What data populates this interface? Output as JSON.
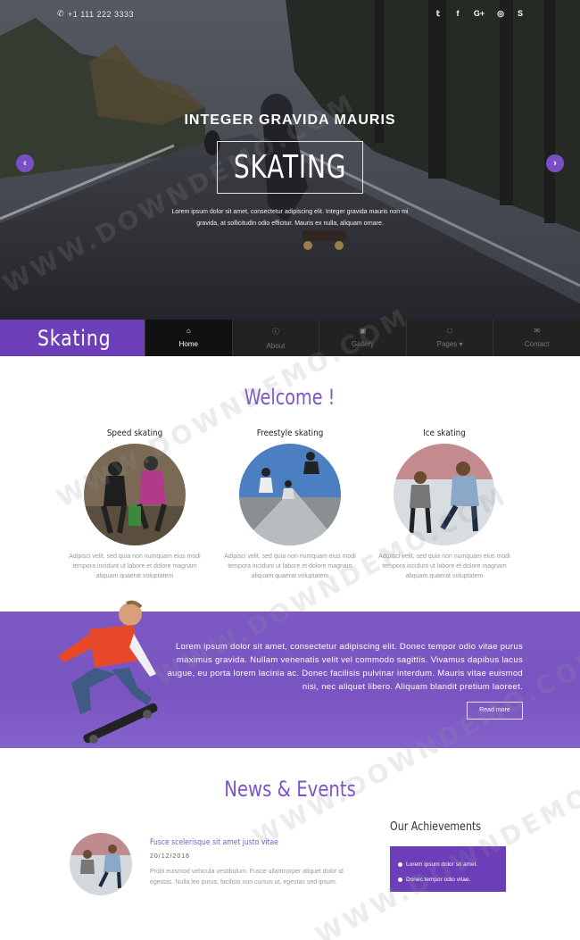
{
  "topbar": {
    "phone": "+1 111 222 3333",
    "social": [
      "twitter-icon",
      "facebook-icon",
      "google-plus-icon",
      "dribbble-icon",
      "skype-icon"
    ]
  },
  "hero": {
    "subtitle": "INTEGER GRAVIDA MAURIS",
    "title": "SKATING",
    "text": "Lorem ipsum dolor sit amet, consectetur adipiscing elit. Integer gravida mauris non mi gravida, at sollicitudin odio efficitur. Mauris ex nulla, aliquam ornare."
  },
  "nav": {
    "logo": "Skating",
    "items": [
      {
        "label": "Home",
        "icon": "home-icon",
        "active": true
      },
      {
        "label": "About",
        "icon": "info-icon"
      },
      {
        "label": "Gallery",
        "icon": "image-icon"
      },
      {
        "label": "Pages",
        "icon": "file-icon"
      },
      {
        "label": "Contact",
        "icon": "envelope-icon"
      }
    ]
  },
  "welcome": {
    "title": "Welcome !",
    "cards": [
      {
        "title": "Speed skating",
        "text": "Adipisci velit, sed quia non numquam eius modi tempora incidunt ut labore et dolore magnam aliquam quaerat voluptatem"
      },
      {
        "title": "Freestyle skating",
        "text": "Adipisci velit, sed quia non numquam eius modi tempora incidunt ut labore et dolore magnam aliquam quaerat voluptatem"
      },
      {
        "title": "Ice skating",
        "text": "Adipisci velit, sed quia non numquam eius modi tempora incidunt ut labore et dolore magnam aliquam quaerat voluptatem"
      }
    ]
  },
  "band": {
    "text": "Lorem ipsum dolor sit amet, consectetur adipiscing elit. Donec tempor odio vitae purus maximus gravida. Nullam venenatis velit vel commodo sagittis. Vivamus dapibus lacus augue, eu porta lorem lacinia ac. Donec facilisis pulvinar interdum. Mauris vitae euismod nisi, nec aliquet libero. Aliquam blandit pretium laoreet.",
    "button": "Read more"
  },
  "news": {
    "title": "News & Events",
    "link": "Fusce scelerisque sit amet justo vitae",
    "date": "20/12/2016",
    "body": "Proin euismod vehicula vestibulum. Fusce ullamcorper aliquet dolor id egestas. Nulla leo purus, facilisis non cursus ut, egestas sed ipsum."
  },
  "achievements": {
    "title": "Our Achievements",
    "items": [
      "Lorem ipsum dolor sit amet.",
      "Donec tempor odio vitae."
    ]
  },
  "watermark": "WWW.DOWNDEMO.COM",
  "colors": {
    "accent": "#6c3fb9",
    "nav_bg": "#222222"
  }
}
